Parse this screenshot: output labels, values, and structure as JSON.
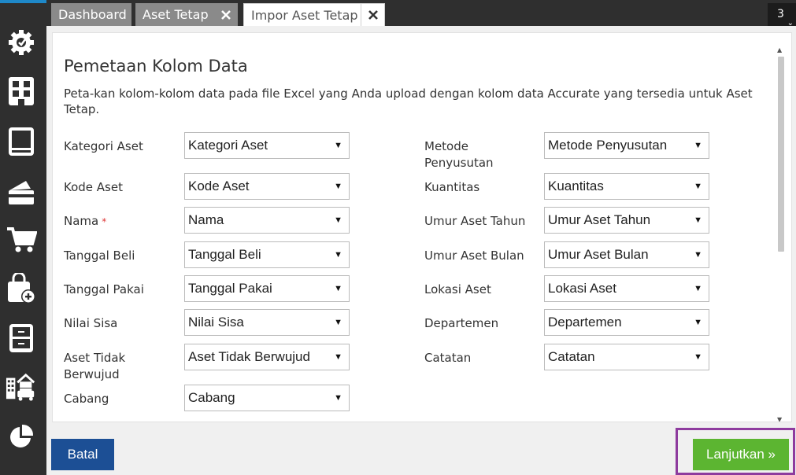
{
  "tabs": {
    "dashboard": "Dashboard",
    "aset_tetap": "Aset Tetap",
    "impor_aset_tetap": "Impor Aset Tetap",
    "count": "3"
  },
  "sidebar": {
    "icons": [
      "settings-gear-icon",
      "building-icon",
      "ledger-book-icon",
      "payment-card-icon",
      "shopping-cart-icon",
      "add-bag-icon",
      "cabinet-icon",
      "buildings-car-icon",
      "pie-chart-icon"
    ]
  },
  "page": {
    "title": "Pemetaan Kolom Data",
    "description": "Peta-kan kolom-kolom data pada file Excel yang Anda upload dengan kolom data Accurate yang tersedia untuk Aset Tetap."
  },
  "left_fields": [
    {
      "label": "Kategori Aset",
      "value": "Kategori Aset"
    },
    {
      "label": "Kode Aset",
      "value": "Kode Aset"
    },
    {
      "label": "Nama",
      "value": "Nama",
      "required": "*"
    },
    {
      "label": "Tanggal Beli",
      "value": "Tanggal Beli"
    },
    {
      "label": "Tanggal Pakai",
      "value": "Tanggal Pakai"
    },
    {
      "label": "Nilai Sisa",
      "value": "Nilai Sisa"
    },
    {
      "label": "Aset Tidak Berwujud",
      "value": "Aset Tidak Berwujud"
    },
    {
      "label": "Cabang",
      "value": "Cabang"
    }
  ],
  "right_fields": [
    {
      "label": "Metode Penyusutan",
      "value": "Metode Penyusutan"
    },
    {
      "label": "Kuantitas",
      "value": "Kuantitas"
    },
    {
      "label": "Umur Aset Tahun",
      "value": "Umur Aset Tahun"
    },
    {
      "label": "Umur Aset Bulan",
      "value": "Umur Aset Bulan"
    },
    {
      "label": "Lokasi Aset",
      "value": "Lokasi Aset"
    },
    {
      "label": "Departemen",
      "value": "Departemen"
    },
    {
      "label": "Catatan",
      "value": "Catatan"
    }
  ],
  "buttons": {
    "batal": "Batal",
    "lanjutkan": "Lanjutkan »"
  },
  "colors": {
    "sidebar": "#2f2f2f",
    "batal": "#1c4f95",
    "lanjutkan": "#5cb531",
    "highlight": "#8e3b9e"
  }
}
